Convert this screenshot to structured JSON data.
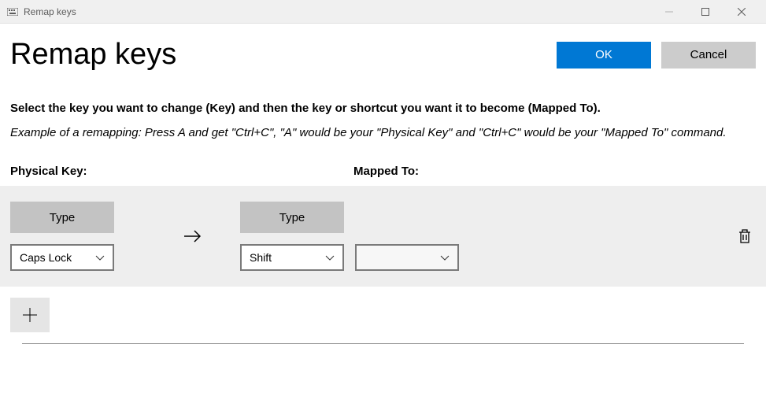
{
  "window": {
    "title": "Remap keys"
  },
  "header": {
    "title": "Remap keys",
    "ok": "OK",
    "cancel": "Cancel"
  },
  "instruction": "Select the key you want to change (Key) and then the key or shortcut you want it to become (Mapped To).",
  "example": "Example of a remapping: Press A and get \"Ctrl+C\", \"A\" would be your \"Physical Key\" and \"Ctrl+C\" would be your \"Mapped To\" command.",
  "columns": {
    "physical": "Physical Key:",
    "mapped": "Mapped To:"
  },
  "row": {
    "type_label": "Type",
    "physical_key": "Caps Lock",
    "mapped_key": "Shift",
    "mapped_key2": ""
  }
}
